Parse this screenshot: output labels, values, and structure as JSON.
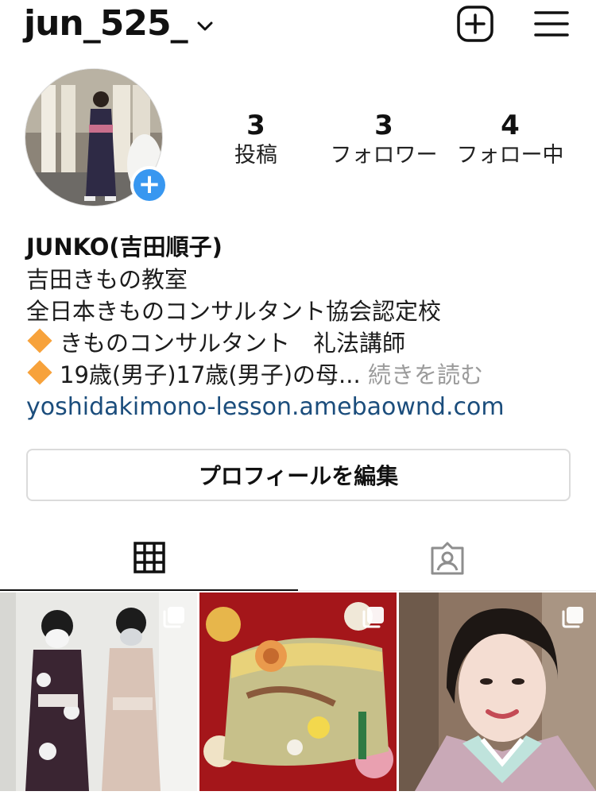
{
  "header": {
    "username": "jun_525_",
    "chevron_icon": "chevron-down-icon",
    "new_post_icon": "plus-square-icon",
    "menu_icon": "hamburger-menu-icon"
  },
  "stats": {
    "posts": {
      "value": "3",
      "label": "投稿"
    },
    "followers": {
      "value": "3",
      "label": "フォロワー"
    },
    "following": {
      "value": "4",
      "label": "フォロー中"
    }
  },
  "bio": {
    "name": "JUNKO(吉田順子)",
    "lines": [
      "吉田きもの教室",
      "全日本きものコンサルタント協会認定校",
      "きものコンサルタント　礼法講師",
      "19歳(男子)17歳(男子)の母..."
    ],
    "more": "続きを読む",
    "link": "yoshidakimono-lesson.amebaownd.com"
  },
  "edit_profile_button": "プロフィールを編集",
  "tabs": [
    {
      "id": "grid",
      "icon": "grid-icon",
      "active": true
    },
    {
      "id": "tagged",
      "icon": "tagged-person-icon",
      "active": false
    }
  ],
  "posts": [
    {
      "icon": "multiple-images-icon"
    },
    {
      "icon": "multiple-images-icon"
    },
    {
      "icon": "multiple-images-icon"
    }
  ],
  "colors": {
    "accent_blue": "#3897f0",
    "link": "#1b4d7c",
    "diamond": "#f7a23b",
    "border": "#dbdbdb"
  }
}
